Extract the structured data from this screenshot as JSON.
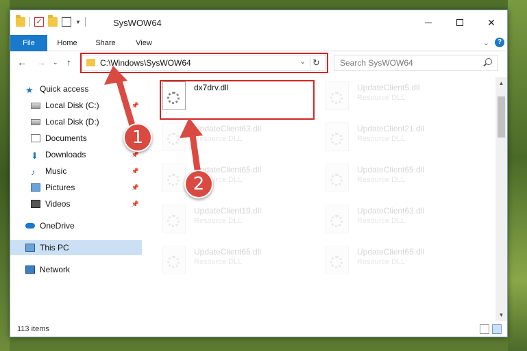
{
  "window": {
    "title": "SysWOW64",
    "controls": {
      "minimize": "—",
      "maximize": "☐",
      "close": "✕"
    }
  },
  "ribbon": {
    "tabs": [
      {
        "label": "File"
      },
      {
        "label": "Home"
      },
      {
        "label": "Share"
      },
      {
        "label": "View"
      }
    ],
    "help": "?"
  },
  "address": {
    "path": "C:\\Windows\\SysWOW64",
    "search_placeholder": "Search SysWOW64"
  },
  "nav": {
    "items": [
      {
        "label": "Quick access"
      },
      {
        "label": "Local Disk (C:)"
      },
      {
        "label": "Local Disk (D:)"
      },
      {
        "label": "Documents"
      },
      {
        "label": "Downloads"
      },
      {
        "label": "Music"
      },
      {
        "label": "Pictures"
      },
      {
        "label": "Videos"
      },
      {
        "label": "OneDrive"
      },
      {
        "label": "This PC"
      },
      {
        "label": "Network"
      }
    ]
  },
  "files": [
    {
      "name": "dx7drv.dll",
      "type": ""
    },
    {
      "name": "UpdateClient5.dll",
      "type": "Resource DLL"
    },
    {
      "name": "UpdateClient63.dll",
      "type": "Resource DLL"
    },
    {
      "name": "UpdateClient21.dll",
      "type": "Resource DLL"
    },
    {
      "name": "UpdateClient65.dll",
      "type": "Resource DLL"
    },
    {
      "name": "UpdateClient65.dll",
      "type": "Resource DLL"
    },
    {
      "name": "UpdateClient19.dll",
      "type": "Resource DLL"
    },
    {
      "name": "UpdateClient63.dll",
      "type": "Resource DLL"
    },
    {
      "name": "UpdateClient65.dll",
      "type": "Resource DLL"
    },
    {
      "name": "UpdateClient65.dll",
      "type": "Resource DLL"
    }
  ],
  "status": {
    "item_count": "113 items"
  },
  "annotations": {
    "step1": "1",
    "step2": "2"
  },
  "colors": {
    "accent": "#1979ca",
    "highlight": "#d62424",
    "badge": "#d94a42",
    "selected": "#cce0f5"
  }
}
